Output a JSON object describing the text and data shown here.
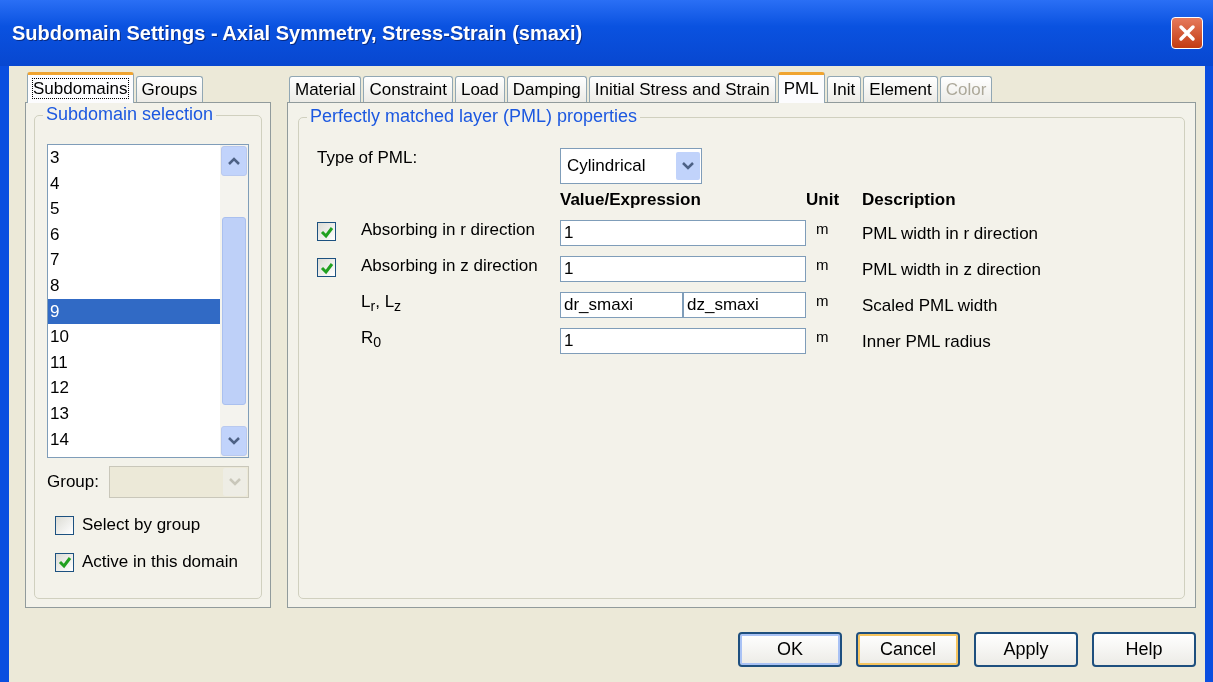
{
  "window": {
    "title": "Subdomain Settings - Axial Symmetry, Stress-Strain (smaxi)"
  },
  "left_tabs": [
    {
      "label": "Subdomains",
      "selected": true
    },
    {
      "label": "Groups",
      "selected": false
    }
  ],
  "subdomain_selection": {
    "title": "Subdomain selection",
    "items": [
      {
        "label": "3",
        "selected": false
      },
      {
        "label": "4",
        "selected": false
      },
      {
        "label": "5",
        "selected": false
      },
      {
        "label": "6",
        "selected": false
      },
      {
        "label": "7",
        "selected": false
      },
      {
        "label": "8",
        "selected": false
      },
      {
        "label": "9",
        "selected": true
      },
      {
        "label": "10",
        "selected": false
      },
      {
        "label": "11",
        "selected": false
      },
      {
        "label": "12",
        "selected": false
      },
      {
        "label": "13",
        "selected": false
      },
      {
        "label": "14",
        "selected": false
      }
    ],
    "group_label": "Group:",
    "options": [
      {
        "label": "Select by group",
        "checked": false
      },
      {
        "label": "Active in this domain",
        "checked": true
      }
    ]
  },
  "tabs": [
    {
      "label": "Material",
      "selected": false,
      "disabled": false
    },
    {
      "label": "Constraint",
      "selected": false,
      "disabled": false
    },
    {
      "label": "Load",
      "selected": false,
      "disabled": false
    },
    {
      "label": "Damping",
      "selected": false,
      "disabled": false
    },
    {
      "label": "Initial Stress and Strain",
      "selected": false,
      "disabled": false
    },
    {
      "label": "PML",
      "selected": true,
      "disabled": false
    },
    {
      "label": "Init",
      "selected": false,
      "disabled": false
    },
    {
      "label": "Element",
      "selected": false,
      "disabled": false
    },
    {
      "label": "Color",
      "selected": false,
      "disabled": true
    }
  ],
  "pml": {
    "title": "Perfectly matched layer (PML) properties",
    "type_label": "Type of PML:",
    "type_value": "Cylindrical",
    "headers": [
      "Value/Expression",
      "Unit",
      "Description"
    ],
    "rows": [
      {
        "kind": "checkbox",
        "checked": true,
        "label": "Absorbing in r direction",
        "values": [
          "1"
        ],
        "unit": "m",
        "description": "PML width in r direction"
      },
      {
        "kind": "checkbox",
        "checked": true,
        "label": "Absorbing in z direction",
        "values": [
          "1"
        ],
        "unit": "m",
        "description": "PML width in z direction"
      },
      {
        "kind": "plain",
        "label": "L$_{r}$, L$_{z}$",
        "values": [
          "dr_smaxi",
          "dz_smaxi"
        ],
        "unit": "m",
        "description": "Scaled PML width"
      },
      {
        "kind": "plain",
        "label": "R$_{0}$",
        "values": [
          "1"
        ],
        "unit": "m",
        "description": "Inner PML radius"
      }
    ]
  },
  "buttons": [
    {
      "label": "OK",
      "kind": "default"
    },
    {
      "label": "Cancel",
      "kind": "focused"
    },
    {
      "label": "Apply",
      "kind": "normal"
    },
    {
      "label": "Help",
      "kind": "normal"
    }
  ]
}
